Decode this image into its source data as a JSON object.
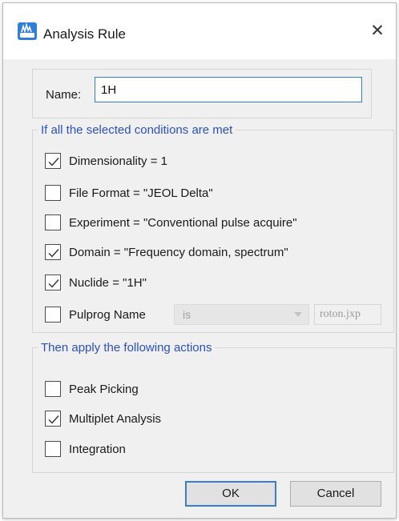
{
  "window": {
    "title": "Analysis Rule",
    "app_icon": "app-icon",
    "close_glyph": "✕"
  },
  "name_field": {
    "label": "Name:",
    "value": "1H"
  },
  "conditions": {
    "title": "If all the selected conditions are met",
    "items": [
      {
        "label": "Dimensionality = 1",
        "checked": true
      },
      {
        "label": "File Format = \"JEOL Delta\"",
        "checked": false
      },
      {
        "label": "Experiment = \"Conventional pulse acquire\"",
        "checked": false
      },
      {
        "label": "Domain = \"Frequency domain, spectrum\"",
        "checked": true
      },
      {
        "label": "Nuclide = \"1H\"",
        "checked": true
      },
      {
        "label": "Pulprog Name",
        "checked": false
      }
    ],
    "pulprog_operator": "is",
    "pulprog_value": "roton.jxp"
  },
  "actions": {
    "title": "Then apply the following actions",
    "items": [
      {
        "label": "Peak Picking",
        "checked": false
      },
      {
        "label": "Multiplet Analysis",
        "checked": true
      },
      {
        "label": "Integration",
        "checked": false
      }
    ]
  },
  "buttons": {
    "ok": "OK",
    "cancel": "Cancel"
  },
  "colors": {
    "accent": "#2b4fc8",
    "focus_border": "#2f7fd8",
    "dialog_bg": "#f0f0f0"
  }
}
